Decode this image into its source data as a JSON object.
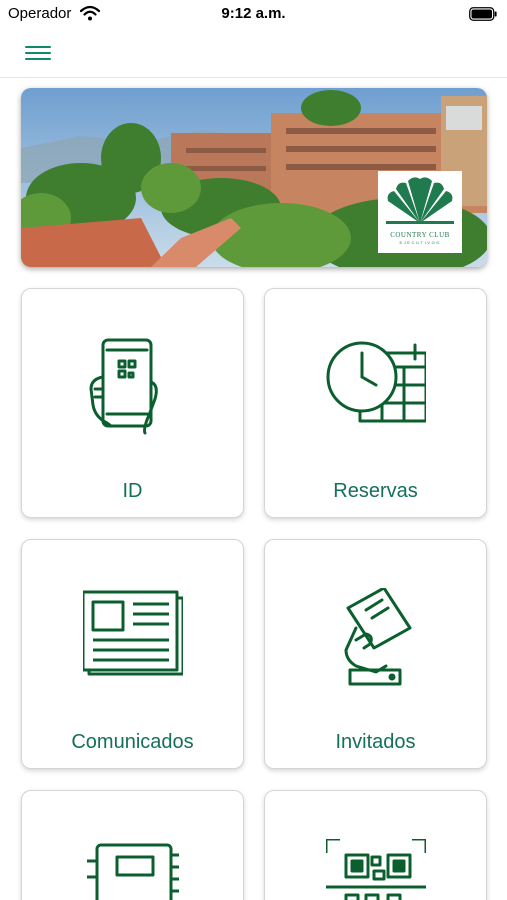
{
  "status_bar": {
    "carrier": "Operador",
    "time": "9:12 a.m.",
    "icons": [
      "wifi-icon",
      "battery-icon"
    ]
  },
  "nav": {
    "menu_icon": "hamburger-menu-icon"
  },
  "banner": {
    "description_icon": "club-photo",
    "logo_text": "COUNTRY CLUB",
    "logo_subtext": "EJECUTIVOS"
  },
  "menu_cards": [
    {
      "label": "ID",
      "icon": "phone-qr-hand-icon"
    },
    {
      "label": "Reservas",
      "icon": "clock-calendar-icon"
    },
    {
      "label": "Comunicados",
      "icon": "newspaper-icon"
    },
    {
      "label": "Invitados",
      "icon": "hand-ticket-icon"
    },
    {
      "label": "",
      "icon": "notebook-icon"
    },
    {
      "label": "",
      "icon": "qr-scan-icon"
    }
  ],
  "colors": {
    "accent": "#0f8a6d",
    "icon_stroke": "#0b5f2e",
    "label": "#14705b"
  }
}
